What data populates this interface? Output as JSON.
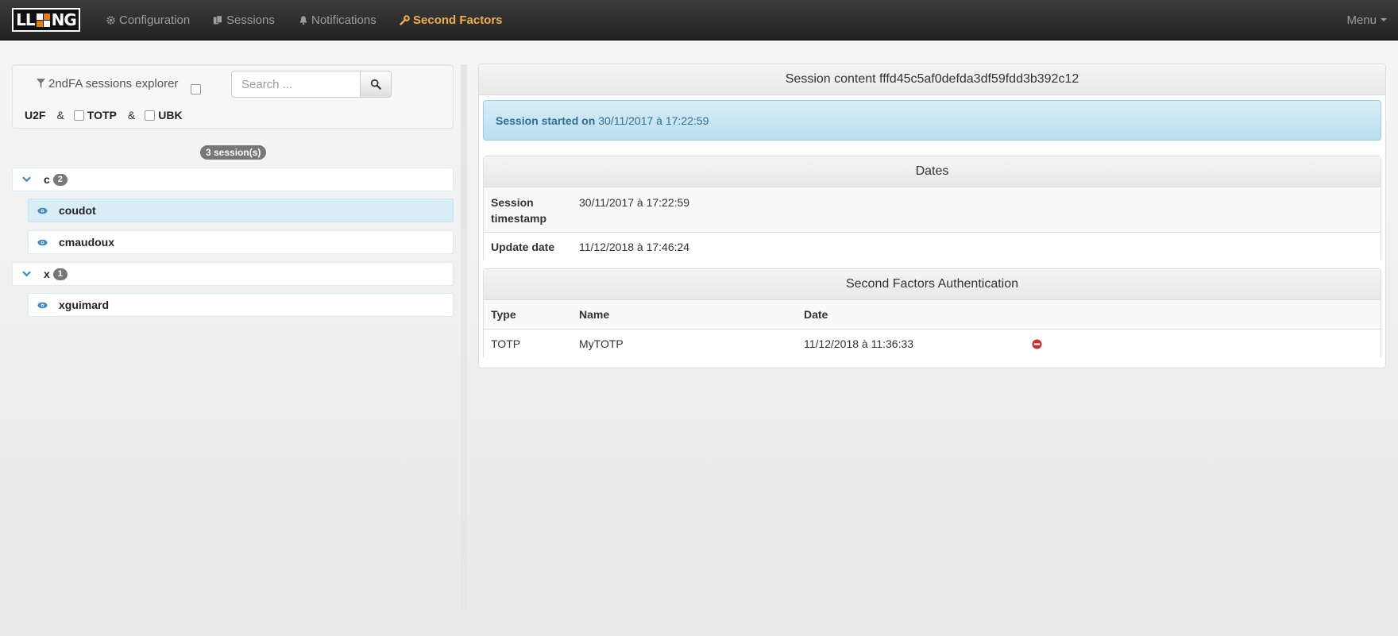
{
  "navbar": {
    "logo_alt": "LL::NG",
    "items": [
      {
        "label": "Configuration",
        "icon": "cog-icon"
      },
      {
        "label": "Sessions",
        "icon": "sessions-icon"
      },
      {
        "label": "Notifications",
        "icon": "bell-icon"
      },
      {
        "label": "Second Factors",
        "icon": "wrench-icon",
        "active": true
      }
    ],
    "menu_label": "Menu"
  },
  "explorer": {
    "title": "2ndFA sessions explorer",
    "search_placeholder": "Search ...",
    "filters": {
      "u2f": "U2F",
      "amp": "&",
      "totp": "TOTP",
      "ubk": "UBK"
    },
    "count_badge": "3 session(s)",
    "groups": [
      {
        "label": "c",
        "count": "2",
        "items": [
          "coudot",
          "cmaudoux"
        ]
      },
      {
        "label": "x",
        "count": "1",
        "items": [
          "xguimard"
        ]
      }
    ]
  },
  "session": {
    "heading": "Session content fffd45c5af0defda3df59fdd3b392c12",
    "alert_label": "Session started on",
    "alert_value": "30/11/2017 à 17:22:59",
    "dates": {
      "title": "Dates",
      "rows": [
        {
          "label_line1": "Session",
          "label_line2": "timestamp",
          "value": "30/11/2017 à 17:22:59"
        },
        {
          "label": "Update date",
          "value": "11/12/2018 à 17:46:24"
        }
      ]
    },
    "sfa": {
      "title": "Second Factors Authentication",
      "headers": {
        "type": "Type",
        "name": "Name",
        "date": "Date"
      },
      "rows": [
        {
          "type": "TOTP",
          "name": "MyTOTP",
          "date": "11/12/2018 à 11:36:33"
        }
      ]
    }
  },
  "colors": {
    "accent": "#f0ad4e",
    "info_text": "#31708f",
    "remove": "#c9302c"
  }
}
